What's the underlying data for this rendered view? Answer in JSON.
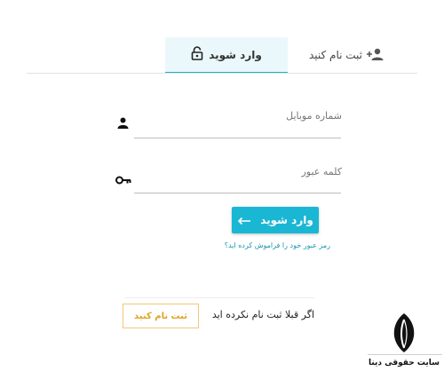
{
  "tabs": {
    "login_label": "وارد شوید",
    "register_label": "ثبت نام کنید"
  },
  "form": {
    "mobile_label": "شماره موبایل",
    "mobile_value": "",
    "password_label": "کلمه عبور",
    "password_value": "",
    "login_button": "وارد شوید",
    "forgot_link": "رمز عبور خود را فراموش کرده اید؟"
  },
  "signup": {
    "prompt": "اگر قبلا ثبت نام نکرده اید",
    "button": "ثبت نام کنید"
  },
  "logo": {
    "text": "سایت حقوقی دینا"
  },
  "colors": {
    "accent": "#1ab7d4",
    "register_border": "#f3c77a",
    "register_text": "#e0a324"
  },
  "icons": {
    "login_tab": "lock-icon",
    "register_tab": "user-plus-icon",
    "mobile": "user-icon",
    "password": "key-icon",
    "login_button": "arrow-left-icon"
  }
}
